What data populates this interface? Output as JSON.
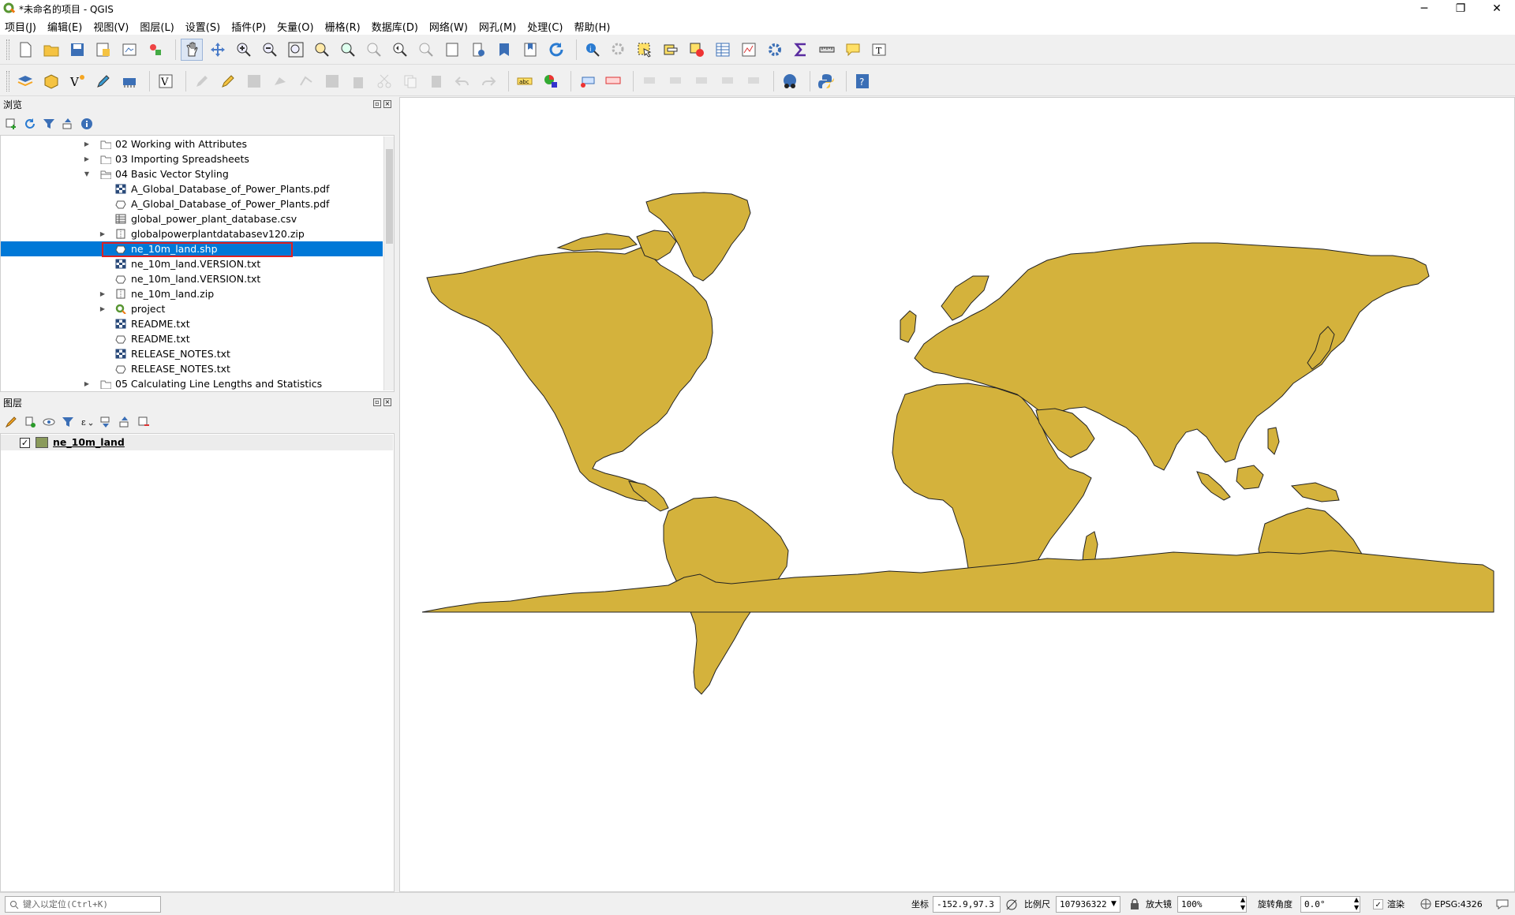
{
  "window": {
    "title": "*未命名的项目 - QGIS",
    "min": "─",
    "restore": "❐",
    "close": "✕"
  },
  "menu": [
    "项目(J)",
    "编辑(E)",
    "视图(V)",
    "图层(L)",
    "设置(S)",
    "插件(P)",
    "矢量(O)",
    "栅格(R)",
    "数据库(D)",
    "网络(W)",
    "网孔(M)",
    "处理(C)",
    "帮助(H)"
  ],
  "browser": {
    "title": "浏览",
    "items": [
      {
        "label": "02 Working with Attributes",
        "icon": "folder-icon",
        "level": 0,
        "arrow": "▶"
      },
      {
        "label": "03 Importing Spreadsheets",
        "icon": "folder-icon",
        "level": 0,
        "arrow": "▶"
      },
      {
        "label": "04 Basic Vector Styling",
        "icon": "folder-open-icon",
        "level": 0,
        "arrow": "▼"
      },
      {
        "label": "A_Global_Database_of_Power_Plants.pdf",
        "icon": "raster-icon",
        "level": 1,
        "arrow": ""
      },
      {
        "label": "A_Global_Database_of_Power_Plants.pdf",
        "icon": "vector-polygon-icon",
        "level": 1,
        "arrow": ""
      },
      {
        "label": "global_power_plant_database.csv",
        "icon": "table-icon",
        "level": 1,
        "arrow": ""
      },
      {
        "label": "globalpowerplantdatabasev120.zip",
        "icon": "zip-icon",
        "level": 1,
        "arrow": "▶"
      },
      {
        "label": "ne_10m_land.shp",
        "icon": "vector-polygon-icon",
        "level": 1,
        "arrow": "",
        "selected": true
      },
      {
        "label": "ne_10m_land.VERSION.txt",
        "icon": "raster-icon",
        "level": 1,
        "arrow": ""
      },
      {
        "label": "ne_10m_land.VERSION.txt",
        "icon": "vector-polygon-icon",
        "level": 1,
        "arrow": ""
      },
      {
        "label": "ne_10m_land.zip",
        "icon": "zip-icon",
        "level": 1,
        "arrow": "▶"
      },
      {
        "label": "project",
        "icon": "qgis-project-icon",
        "level": 1,
        "arrow": "▶"
      },
      {
        "label": "README.txt",
        "icon": "raster-icon",
        "level": 1,
        "arrow": ""
      },
      {
        "label": "README.txt",
        "icon": "vector-polygon-icon",
        "level": 1,
        "arrow": ""
      },
      {
        "label": "RELEASE_NOTES.txt",
        "icon": "raster-icon",
        "level": 1,
        "arrow": ""
      },
      {
        "label": "RELEASE_NOTES.txt",
        "icon": "vector-polygon-icon",
        "level": 1,
        "arrow": ""
      },
      {
        "label": "05 Calculating Line Lengths and Statistics",
        "icon": "folder-icon",
        "level": 0,
        "arrow": "▶"
      }
    ]
  },
  "layers": {
    "title": "图层",
    "items": [
      {
        "name": "ne_10m_land",
        "checked": "✓",
        "color": "#8a9a5b"
      }
    ]
  },
  "map": {
    "land_color": "#d4b23c",
    "outline_color": "#222222"
  },
  "status": {
    "locator_placeholder": "键入以定位(Ctrl+K)",
    "coord_label": "坐标",
    "coord_value": "-152.9,97.3",
    "scale_label": "比例尺",
    "scale_value": "107936322",
    "magnifier_label": "放大镜",
    "magnifier_value": "100%",
    "rotation_label": "旋转角度",
    "rotation_value": "0.0°",
    "render_label": "渲染",
    "render_checked": "✓",
    "crs": "EPSG:4326"
  }
}
